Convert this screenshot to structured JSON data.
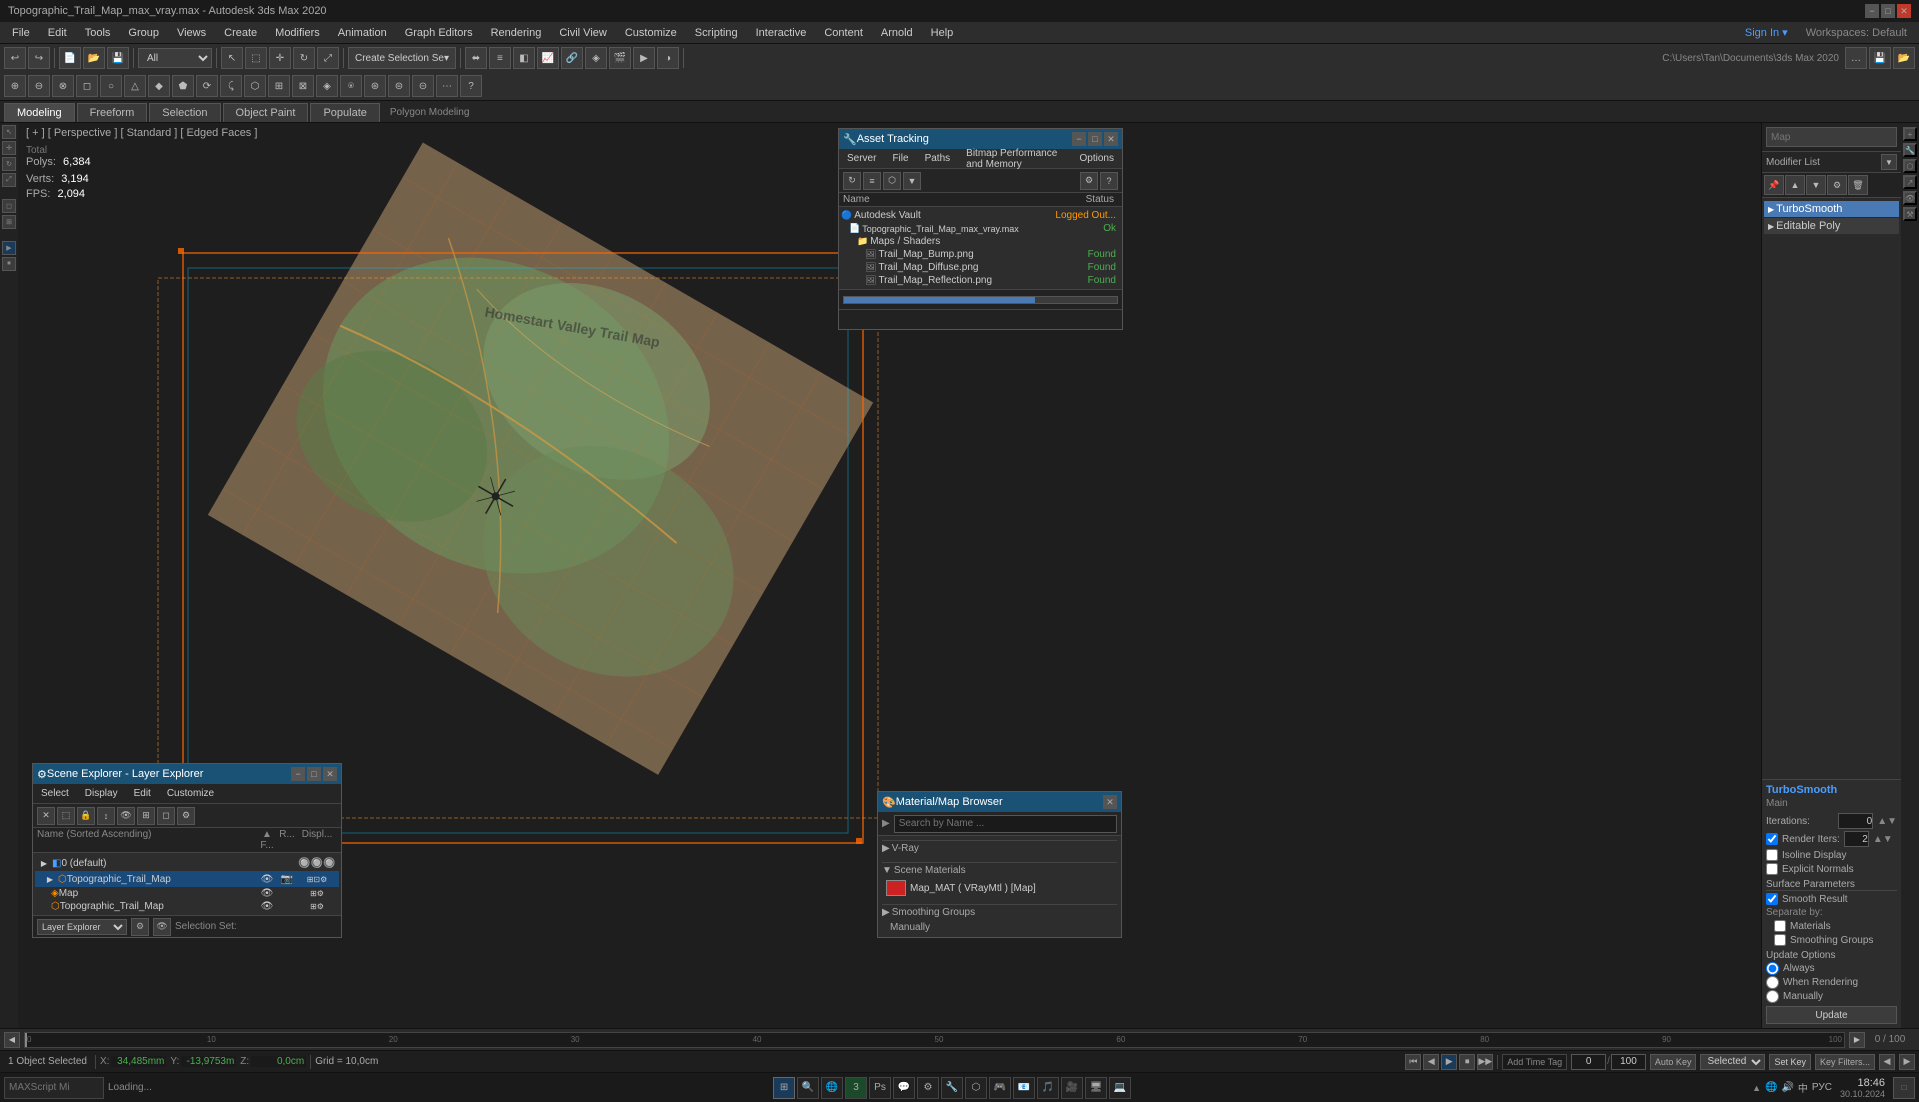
{
  "window": {
    "title": "Topographic_Trail_Map_max_vray.max - Autodesk 3ds Max 2020",
    "controls": [
      "−",
      "□",
      "✕"
    ]
  },
  "menu": {
    "items": [
      "File",
      "Edit",
      "Tools",
      "Group",
      "Views",
      "Create",
      "Modifiers",
      "Animation",
      "Graph Editors",
      "Rendering",
      "Civil View",
      "Customize",
      "Scripting",
      "Interactive",
      "Content",
      "Arnold",
      "Help"
    ]
  },
  "toolbar1": {
    "undo_icon": "↩",
    "redo_icon": "↪",
    "select_mode": "All",
    "create_sel_btn": "Create Selection Se▾",
    "filepath": "C:\\Users\\Tan\\Documents\\3ds Max 2020",
    "sign_in": "Sign In ▾",
    "workspaces": "Workspaces: Default"
  },
  "tabs": {
    "items": [
      "Modeling",
      "Freeform",
      "Selection",
      "Object Paint",
      "Populate"
    ],
    "active": "Modeling",
    "sub_label": "Polygon Modeling"
  },
  "viewport": {
    "label": "[ + ] [ Perspective ] [ Standard ] [ Edged Faces ]",
    "stats": {
      "polys_label": "Polys:",
      "polys_total_label": "Total",
      "polys_val": "6,384",
      "verts_label": "Verts:",
      "verts_val": "3,194",
      "fps_label": "FPS:",
      "fps_val": "2,094"
    }
  },
  "modifier_panel": {
    "search_placeholder": "Map",
    "modifier_list_label": "Modifier List",
    "modifiers": [
      "TurboSmooth",
      "Editable Poly"
    ],
    "active_modifier": "TurboSmooth",
    "sections": {
      "turbosmoother": {
        "title": "TurboSmooth",
        "main_label": "Main",
        "iterations_label": "Iterations:",
        "iterations_val": "0",
        "render_iters_label": "Render Iters:",
        "render_iters_val": "2",
        "isoline_display": "Isoline Display",
        "explicit_normals": "Explicit Normals",
        "surface_params_label": "Surface Parameters",
        "smooth_result": "Smooth Result",
        "separate_by_label": "Separate by:",
        "materials": "Materials",
        "smoothing_groups": "Smoothing Groups",
        "update_options_label": "Update Options",
        "always": "Always",
        "when_rendering": "When Rendering",
        "manually": "Manually",
        "update_btn": "Update"
      }
    }
  },
  "asset_tracking": {
    "title": "Asset Tracking",
    "icon": "🔧",
    "menus": [
      "Server",
      "File",
      "Paths",
      "Bitmap Performance and Memory",
      "Options"
    ],
    "header": {
      "name": "Name",
      "status": "Status"
    },
    "tree": [
      {
        "level": 0,
        "icon": "🔵",
        "name": "Autodesk Vault",
        "status": "Logged Out..."
      },
      {
        "level": 1,
        "icon": "📄",
        "name": "Topographic_Trail_Map_max_vray.max",
        "status": "Ok"
      },
      {
        "level": 2,
        "icon": "📁",
        "name": "Maps / Shaders",
        "status": ""
      },
      {
        "level": 3,
        "icon": "🖼",
        "name": "Trail_Map_Bump.png",
        "status": "Found"
      },
      {
        "level": 3,
        "icon": "🖼",
        "name": "Trail_Map_Diffuse.png",
        "status": "Found"
      },
      {
        "level": 3,
        "icon": "🖼",
        "name": "Trail_Map_Reflection.png",
        "status": "Found"
      }
    ]
  },
  "scene_explorer": {
    "title": "Scene Explorer - Layer Explorer",
    "menus": [
      "Select",
      "Display",
      "Edit",
      "Customize"
    ],
    "header": {
      "name": "Name (Sorted Ascending)",
      "f": "▲ F...",
      "r": "R...",
      "disp": "Displ..."
    },
    "tree": [
      {
        "level": 0,
        "type": "layer",
        "name": "0 (default)",
        "selected": false
      },
      {
        "level": 1,
        "type": "obj",
        "name": "Topographic_Trail_Map",
        "selected": true
      },
      {
        "level": 2,
        "type": "obj",
        "name": "Map",
        "selected": false
      },
      {
        "level": 2,
        "type": "obj",
        "name": "Topographic_Trail_Map",
        "selected": false
      }
    ],
    "bottom_label": "Layer Explorer",
    "selection_set": "Selection Set:"
  },
  "material_browser": {
    "title": "Material/Map Browser",
    "search_placeholder": "Search by Name ...",
    "sections": {
      "vray_label": "V-Ray",
      "scene_materials_label": "Scene Materials",
      "materials": [
        {
          "name": "Map_MAT ( VRayMtl ) [Map]",
          "color": "#cc2222"
        }
      ],
      "smoothing_label": "Smoothing Groups",
      "manually_label": "Manually"
    }
  },
  "status_bar": {
    "object_selected": "1 Object Selected",
    "x_label": "X:",
    "x_val": "34,485mm",
    "y_label": "Y:",
    "y_val": "-13,9753m",
    "z_label": "Z:",
    "z_val": "0,0cm",
    "grid_label": "Grid = 10,0cm",
    "anim_controls": [
      "⏮",
      "◀",
      "▶",
      "⏹",
      "⏭"
    ],
    "add_time_tag": "Add Time Tag",
    "autokey_label": "Auto Key",
    "selected_label": "Selected",
    "setkey_label": "Set Key",
    "key_filters_label": "Key Filters..."
  },
  "timeline": {
    "range_label": "0 / 100",
    "ticks": [
      "0",
      "10",
      "20",
      "30",
      "40",
      "50",
      "60",
      "70",
      "80",
      "90",
      "100"
    ]
  },
  "bottom": {
    "script_label": "MAXScript Mi",
    "loading_label": "Loading...",
    "time": "18:46",
    "date": "30.10.2024",
    "selected_text": "Selected"
  },
  "taskbar": {
    "start": "⊞",
    "apps": [
      "📁",
      "🌐",
      "⚙",
      "🔷",
      "🎨",
      "📝",
      "🔧",
      "🎮",
      "🖊",
      "🔎",
      "🌍",
      "📧",
      "🎵",
      "🔒",
      "💬",
      "🖥"
    ],
    "sys_tray": [
      "▲",
      "🔊",
      "🌐",
      "中"
    ],
    "time": "18:46",
    "date": "30.10.2024"
  }
}
